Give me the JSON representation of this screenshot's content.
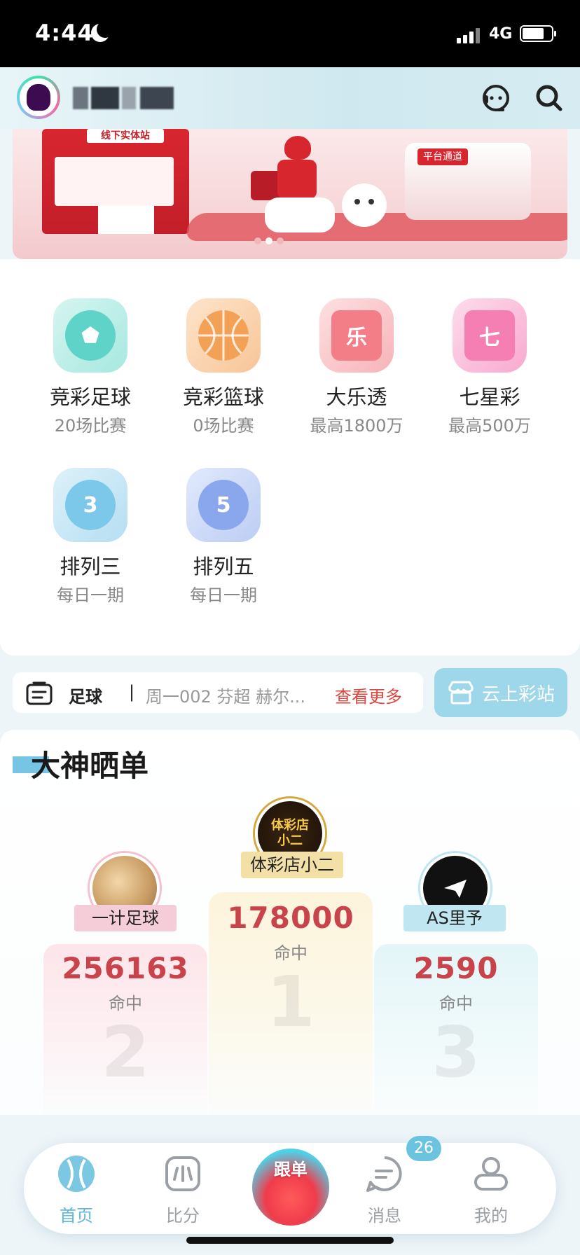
{
  "status_bar": {
    "time": "4:44",
    "network": "4G",
    "battery_level": 0.75
  },
  "header": {
    "service_icon": "headset-icon",
    "search_icon": "search-icon"
  },
  "banner": {
    "shop_sign": "线下实体站",
    "platform_tag": "平台通道",
    "active_slide": 2,
    "slide_count": 3
  },
  "games": [
    {
      "name": "竞彩足球",
      "sub": "20场比赛",
      "icon": "football-icon",
      "glyph": "⚽",
      "color": "#5fd3c8"
    },
    {
      "name": "竞彩篮球",
      "sub": "0场比赛",
      "icon": "basketball-icon",
      "glyph": "",
      "color": "#f3a156"
    },
    {
      "name": "大乐透",
      "sub": "最高1800万",
      "icon": "star-le-icon",
      "glyph": "乐",
      "color": "#f37e88"
    },
    {
      "name": "七星彩",
      "sub": "最高500万",
      "icon": "star-qi-icon",
      "glyph": "七",
      "color": "#f57fb3"
    },
    {
      "name": "排列三",
      "sub": "每日一期",
      "icon": "pailie3-icon",
      "glyph": "3",
      "color": "#7cc8ea"
    },
    {
      "name": "排列五",
      "sub": "每日一期",
      "icon": "pailie5-icon",
      "glyph": "5",
      "color": "#8aa7ee"
    }
  ],
  "notice": {
    "category": "足球",
    "separator": "|",
    "text": "周一002 芬超 赫尔...",
    "more": "查看更多"
  },
  "cloud_station": {
    "label": "云上彩站"
  },
  "showcase": {
    "title": "大神晒单",
    "hit_label": "命中",
    "podium": [
      {
        "rank": "1",
        "name": "体彩店小二",
        "score": "178000",
        "avatar_text": "体彩店小二"
      },
      {
        "rank": "2",
        "name": "一计足球",
        "score": "256163"
      },
      {
        "rank": "3",
        "name": "AS里予",
        "score": "2590"
      }
    ]
  },
  "nav": {
    "items": [
      {
        "label": "首页",
        "icon": "home-ball-icon"
      },
      {
        "label": "比分",
        "icon": "score-icon"
      },
      {
        "label": "跟单",
        "icon": "follow-mascot-icon"
      },
      {
        "label": "消息",
        "icon": "message-icon",
        "badge": "26"
      },
      {
        "label": "我的",
        "icon": "profile-icon"
      }
    ],
    "active_color": "#5fb8d9"
  }
}
